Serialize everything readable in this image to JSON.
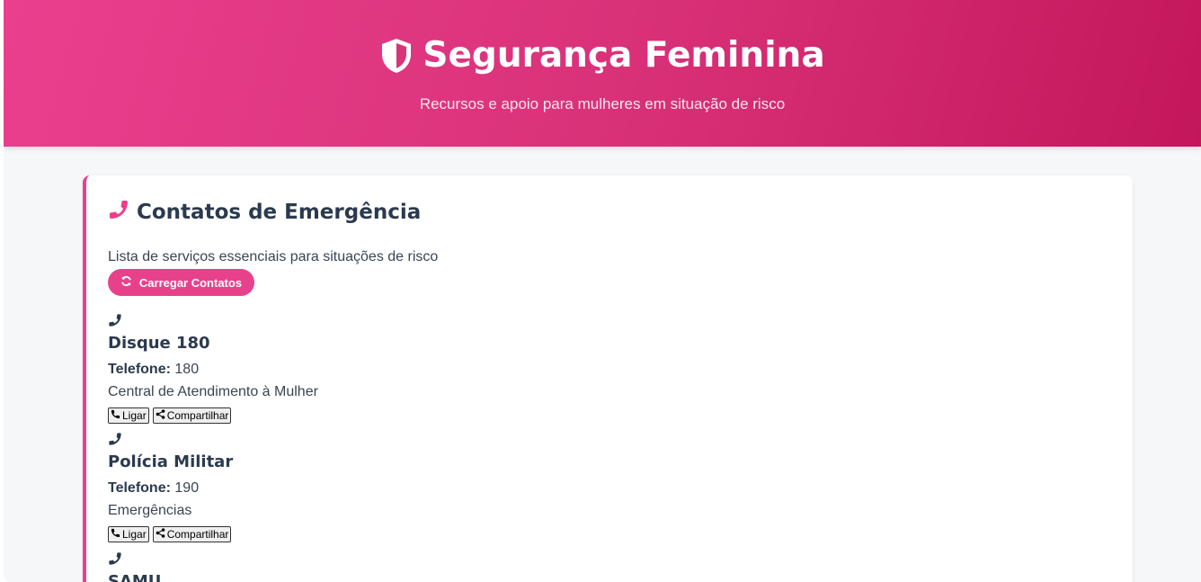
{
  "header": {
    "title": "Segurança Feminina",
    "subtitle": "Recursos e apoio para mulheres em situação de risco",
    "icon": "shield-icon"
  },
  "card": {
    "title": "Contatos de Emergência",
    "description": "Lista de serviços essenciais para situações de risco",
    "load_button": "Carregar Contatos",
    "icon": "phone-icon"
  },
  "contacts": [
    {
      "name": "Disque 180",
      "phone_label": "Telefone:",
      "phone": "180",
      "description": "Central de Atendimento à Mulher",
      "call_label": "Ligar",
      "share_label": "Compartilhar"
    },
    {
      "name": "Polícia Militar",
      "phone_label": "Telefone:",
      "phone": "190",
      "description": "Emergências",
      "call_label": "Ligar",
      "share_label": "Compartilhar"
    },
    {
      "name": "SAMU"
    }
  ],
  "colors": {
    "accent": "#e8418c",
    "header_start": "#ea3f8e",
    "header_end": "#c4175b",
    "text_dark": "#2b3a4e",
    "background": "#f6f7f9"
  }
}
